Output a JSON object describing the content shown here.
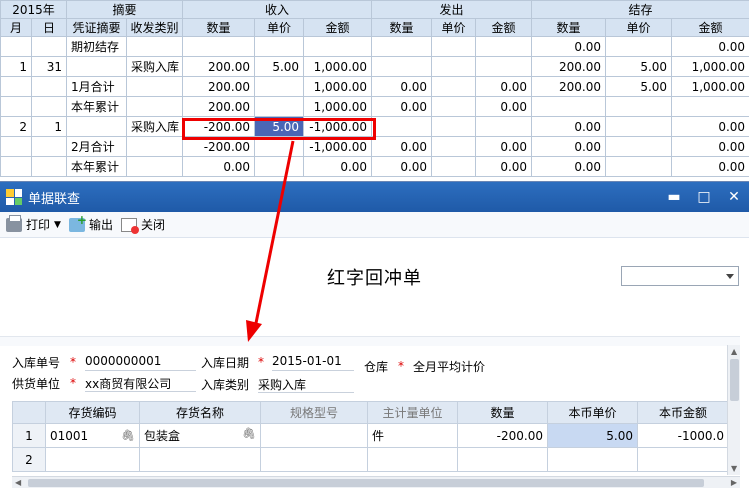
{
  "ledger": {
    "groups": {
      "year": "2015年",
      "summary": "摘要",
      "in": "收入",
      "out": "发出",
      "balance": "结存"
    },
    "cols": {
      "month": "月",
      "day": "日",
      "voucher": "凭证摘要",
      "type": "收发类别",
      "qty": "数量",
      "price": "单价",
      "amount": "金额"
    },
    "rows": [
      {
        "month": "",
        "day": "",
        "voucher": "期初结存",
        "type": "",
        "in_qty": "",
        "in_price": "",
        "in_amt": "",
        "out_qty": "",
        "out_price": "",
        "out_amt": "",
        "bal_qty": "0.00",
        "bal_price": "",
        "bal_amt": "0.00"
      },
      {
        "month": "1",
        "day": "31",
        "voucher": "",
        "type": "采购入库",
        "in_qty": "200.00",
        "in_price": "5.00",
        "in_amt": "1,000.00",
        "out_qty": "",
        "out_price": "",
        "out_amt": "",
        "bal_qty": "200.00",
        "bal_price": "5.00",
        "bal_amt": "1,000.00"
      },
      {
        "month": "",
        "day": "",
        "voucher": "1月合计",
        "type": "",
        "in_qty": "200.00",
        "in_price": "",
        "in_amt": "1,000.00",
        "out_qty": "0.00",
        "out_price": "",
        "out_amt": "0.00",
        "bal_qty": "200.00",
        "bal_price": "5.00",
        "bal_amt": "1,000.00"
      },
      {
        "month": "",
        "day": "",
        "voucher": "本年累计",
        "type": "",
        "in_qty": "200.00",
        "in_price": "",
        "in_amt": "1,000.00",
        "out_qty": "0.00",
        "out_price": "",
        "out_amt": "0.00",
        "bal_qty": "",
        "bal_price": "",
        "bal_amt": ""
      },
      {
        "month": "2",
        "day": "1",
        "voucher": "",
        "type": "采购入库",
        "in_qty": "-200.00",
        "in_price": "5.00",
        "in_amt": "-1,000.00",
        "out_qty": "",
        "out_price": "",
        "out_amt": "",
        "bal_qty": "0.00",
        "bal_price": "",
        "bal_amt": "0.00"
      },
      {
        "month": "",
        "day": "",
        "voucher": "2月合计",
        "type": "",
        "in_qty": "-200.00",
        "in_price": "",
        "in_amt": "-1,000.00",
        "out_qty": "0.00",
        "out_price": "",
        "out_amt": "0.00",
        "bal_qty": "0.00",
        "bal_price": "",
        "bal_amt": "0.00"
      },
      {
        "month": "",
        "day": "",
        "voucher": "本年累计",
        "type": "",
        "in_qty": "0.00",
        "in_price": "",
        "in_amt": "0.00",
        "out_qty": "0.00",
        "out_price": "",
        "out_amt": "0.00",
        "bal_qty": "0.00",
        "bal_price": "",
        "bal_amt": "0.00"
      }
    ]
  },
  "dialog": {
    "title": "单据联查",
    "toolbar": {
      "print": "打印",
      "export": "输出",
      "close": "关闭"
    },
    "doc_title": "红字回冲单",
    "fields": {
      "receipt_no_label": "入库单号",
      "receipt_no": "0000000001",
      "date_label": "入库日期",
      "date": "2015-01-01",
      "warehouse_label": "仓库",
      "warehouse": "全月平均计价",
      "supplier_label": "供货单位",
      "supplier": "xx商贸有限公司",
      "type_label": "入库类别",
      "type": "采购入库"
    },
    "grid": {
      "headers": [
        "存货编码",
        "存货名称",
        "规格型号",
        "主计量单位",
        "数量",
        "本币单价",
        "本币金额"
      ],
      "rows": [
        {
          "n": "1",
          "code": "01001",
          "name": "包装盒",
          "spec": "",
          "unit": "件",
          "qty": "-200.00",
          "price": "5.00",
          "amount": "-1000.0"
        },
        {
          "n": "2",
          "code": "",
          "name": "",
          "spec": "",
          "unit": "",
          "qty": "",
          "price": "",
          "amount": ""
        }
      ]
    }
  },
  "colors": {
    "accent_red": "#e00000",
    "title_blue": "#1f5aa8",
    "selection": "#4a66b5"
  }
}
